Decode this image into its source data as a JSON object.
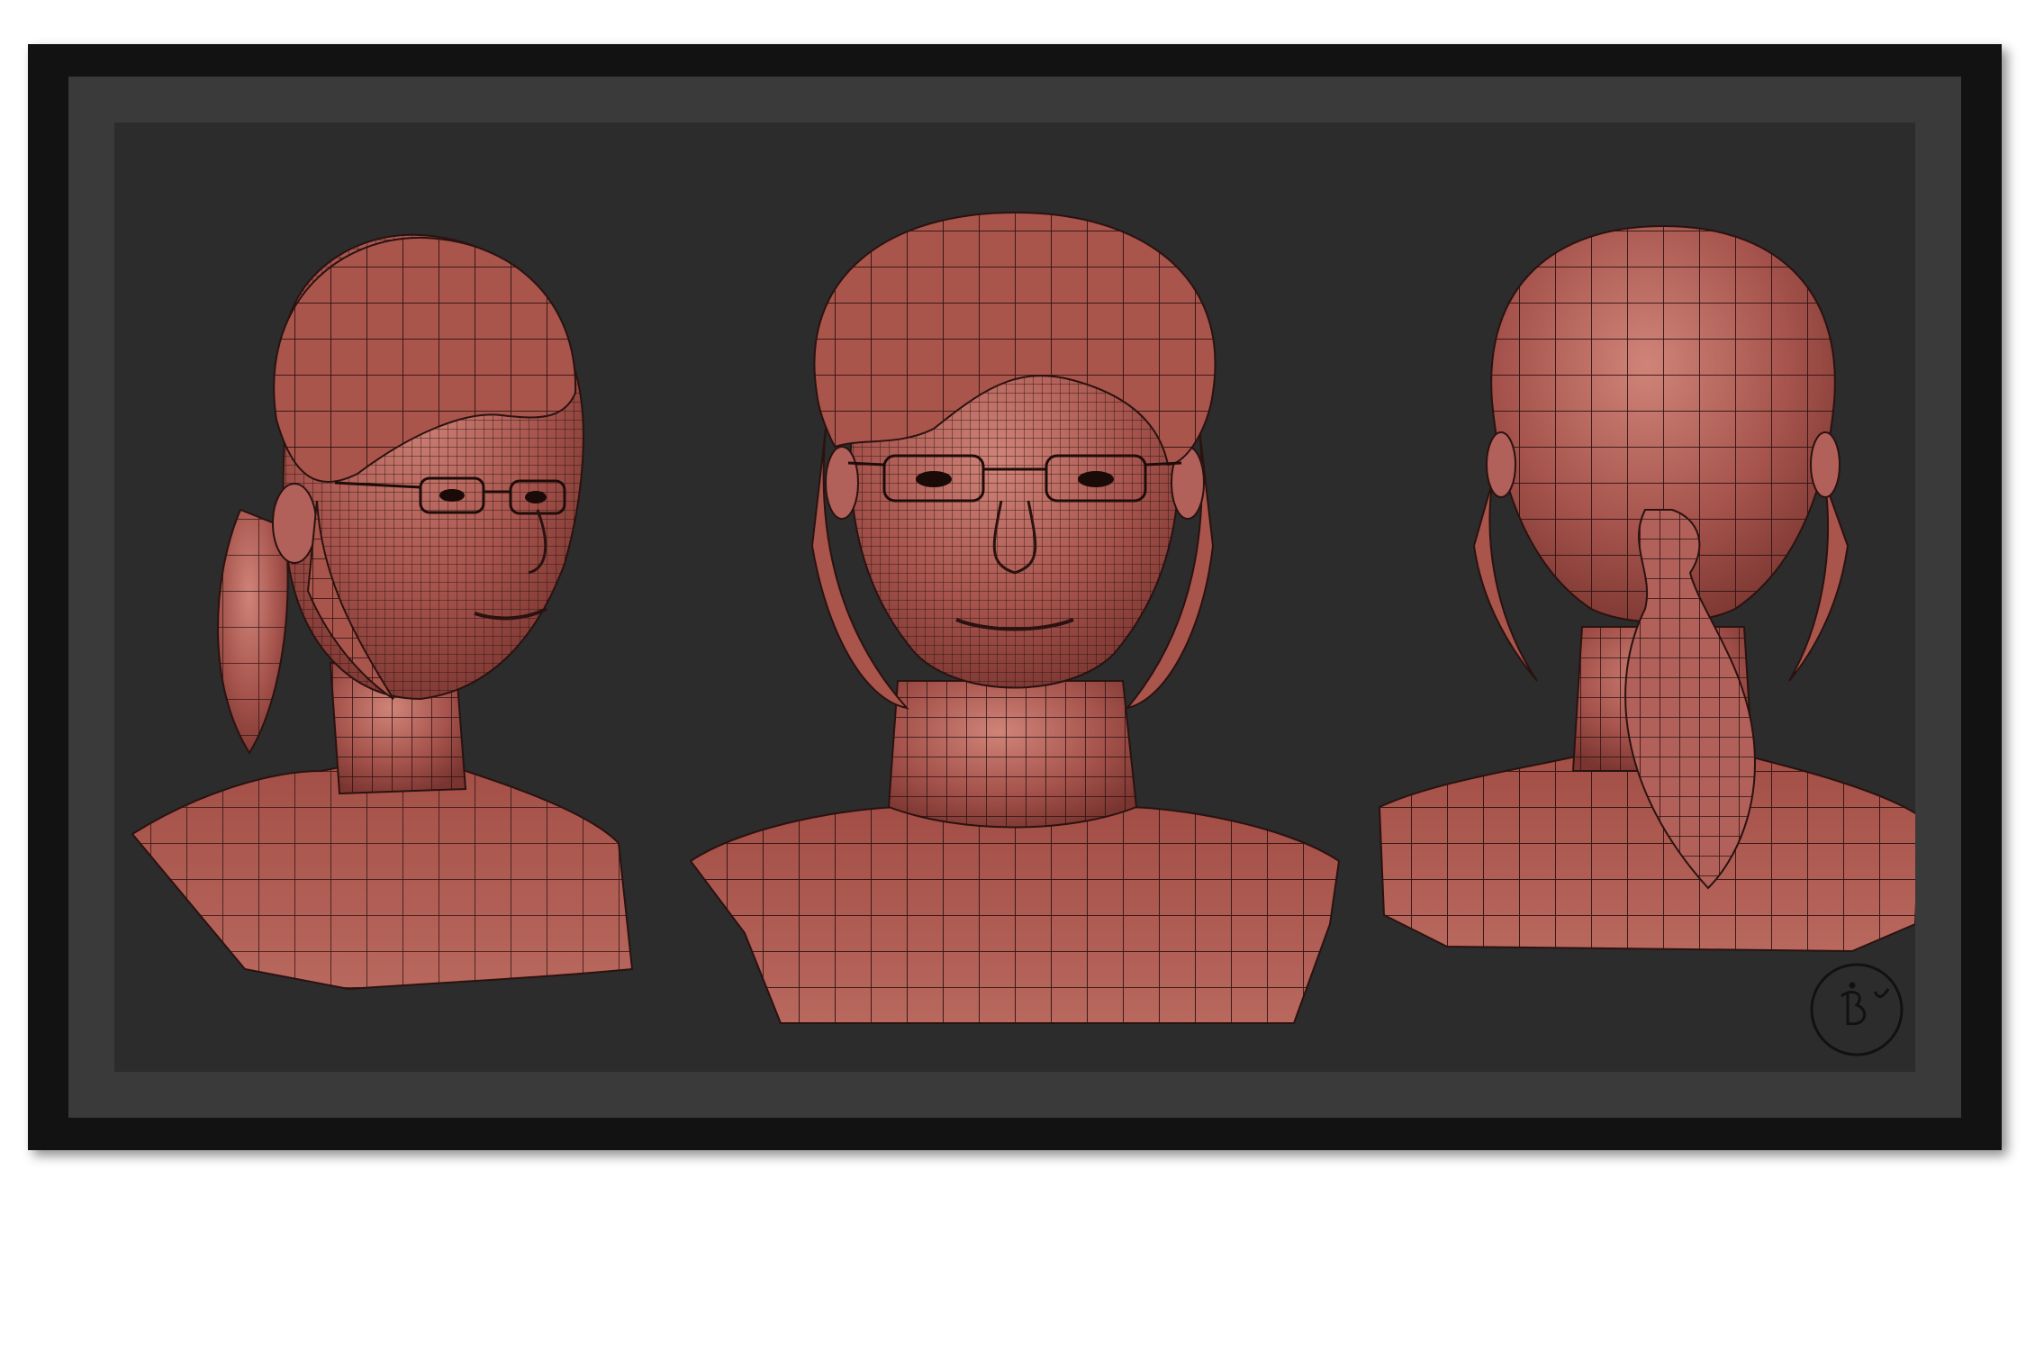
{
  "artwork": {
    "views": [
      {
        "name": "three-quarter-view",
        "label": ""
      },
      {
        "name": "front-view",
        "label": ""
      },
      {
        "name": "back-view",
        "label": ""
      }
    ],
    "colors": {
      "skin": "#a5534c",
      "skin_light": "#c87a70",
      "wire": "#2a1210",
      "background": "#2c2c2c",
      "mat": "#3a3a3a",
      "frame": "#121212"
    },
    "signature_icon": "signature-logo-icon"
  }
}
